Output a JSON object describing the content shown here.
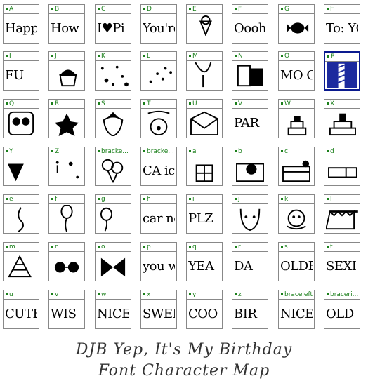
{
  "window": {
    "title": ""
  },
  "grid": {
    "columns": 8,
    "selected_index": 15,
    "cells": [
      {
        "key": "A",
        "sample": "Happ",
        "kind": "text"
      },
      {
        "key": "B",
        "sample": "How m CAND",
        "kind": "text"
      },
      {
        "key": "C",
        "sample": "I♥Pi",
        "kind": "text"
      },
      {
        "key": "D",
        "sample": "You're",
        "kind": "text"
      },
      {
        "key": "E",
        "sample": "",
        "kind": "icecream"
      },
      {
        "key": "F",
        "sample": "Oooh! For w",
        "kind": "text"
      },
      {
        "key": "G",
        "sample": "",
        "kind": "candy"
      },
      {
        "key": "H",
        "sample": "To: YOU",
        "kind": "text"
      },
      {
        "key": "I",
        "sample": "FU",
        "kind": "text"
      },
      {
        "key": "J",
        "sample": "",
        "kind": "cupcake"
      },
      {
        "key": "K",
        "sample": "",
        "kind": "confetti"
      },
      {
        "key": "L",
        "sample": "",
        "kind": "confetti2"
      },
      {
        "key": "M",
        "sample": "",
        "kind": "balloon-half"
      },
      {
        "key": "N",
        "sample": "",
        "kind": "card"
      },
      {
        "key": "O",
        "sample": "MO CA",
        "kind": "text"
      },
      {
        "key": "P",
        "sample": "",
        "kind": "selected"
      },
      {
        "key": "Q",
        "sample": "",
        "kind": "owl"
      },
      {
        "key": "R",
        "sample": "",
        "kind": "star"
      },
      {
        "key": "S",
        "sample": "",
        "kind": "strawberry"
      },
      {
        "key": "T",
        "sample": "",
        "kind": "clown"
      },
      {
        "key": "U",
        "sample": "",
        "kind": "envelope"
      },
      {
        "key": "V",
        "sample": "PAR",
        "kind": "text"
      },
      {
        "key": "W",
        "sample": "",
        "kind": "cake"
      },
      {
        "key": "X",
        "sample": "",
        "kind": "cake2"
      },
      {
        "key": "Y",
        "sample": "",
        "kind": "cone"
      },
      {
        "key": "Z",
        "sample": "",
        "kind": "dots"
      },
      {
        "key": "bracke...",
        "sample": "",
        "kind": "balloons"
      },
      {
        "key": "bracke...",
        "sample": "CA ice c Pre",
        "kind": "text"
      },
      {
        "key": "a",
        "sample": "",
        "kind": "gift"
      },
      {
        "key": "b",
        "sample": "",
        "kind": "gift2"
      },
      {
        "key": "c",
        "sample": "",
        "kind": "gift3"
      },
      {
        "key": "d",
        "sample": "",
        "kind": "gift4"
      },
      {
        "key": "e",
        "sample": "",
        "kind": "string"
      },
      {
        "key": "f",
        "sample": "",
        "kind": "balloon"
      },
      {
        "key": "g",
        "sample": "",
        "kind": "balloon2"
      },
      {
        "key": "h",
        "sample": "car nom nom nom",
        "kind": "text"
      },
      {
        "key": "i",
        "sample": "PLZ",
        "kind": "text"
      },
      {
        "key": "j",
        "sample": "",
        "kind": "face"
      },
      {
        "key": "k",
        "sample": "",
        "kind": "flower"
      },
      {
        "key": "l",
        "sample": "",
        "kind": "crown"
      },
      {
        "key": "m",
        "sample": "",
        "kind": "hat"
      },
      {
        "key": "n",
        "sample": "",
        "kind": "glasses"
      },
      {
        "key": "o",
        "sample": "",
        "kind": "bow"
      },
      {
        "key": "p",
        "sample": "you w Do",
        "kind": "text"
      },
      {
        "key": "q",
        "sample": "YEA",
        "kind": "text"
      },
      {
        "key": "r",
        "sample": "DA",
        "kind": "text"
      },
      {
        "key": "s",
        "sample": "OLDE",
        "kind": "text"
      },
      {
        "key": "t",
        "sample": "SEXI",
        "kind": "text"
      },
      {
        "key": "u",
        "sample": "CUTE",
        "kind": "text"
      },
      {
        "key": "v",
        "sample": "WIS",
        "kind": "text"
      },
      {
        "key": "w",
        "sample": "NICE!",
        "kind": "text"
      },
      {
        "key": "x",
        "sample": "SWEE",
        "kind": "text"
      },
      {
        "key": "y",
        "sample": "COO",
        "kind": "text"
      },
      {
        "key": "z",
        "sample": "BIR",
        "kind": "text"
      },
      {
        "key": "braceleft",
        "sample": "NICE SWEE",
        "kind": "text"
      },
      {
        "key": "braceri...",
        "sample": "OLD SEX",
        "kind": "text"
      }
    ]
  },
  "caption": {
    "line1": "DJB Yep, It's My Birthday",
    "line2": "Font Character Map"
  }
}
